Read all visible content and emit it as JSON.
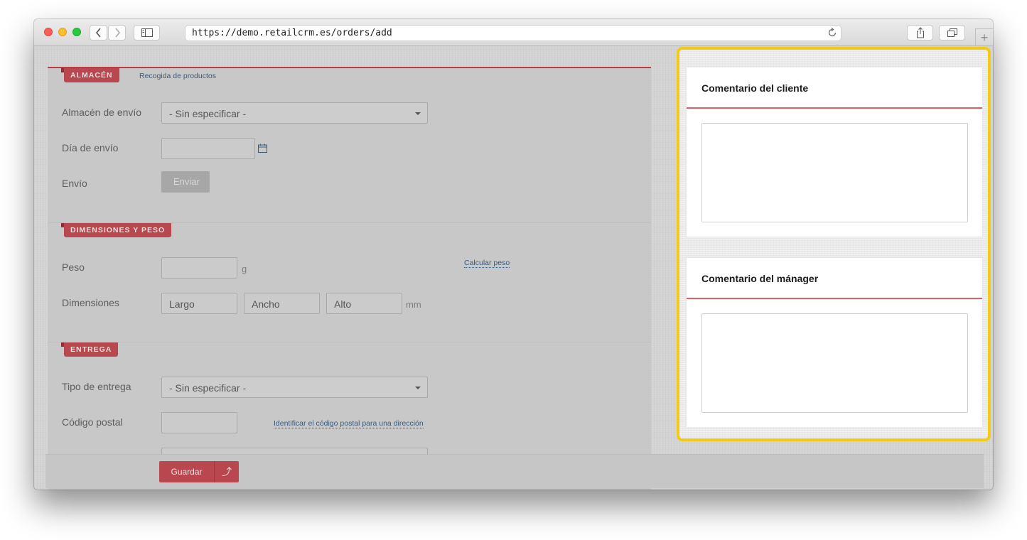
{
  "browser": {
    "url": "https://demo.retailcrm.es/orders/add"
  },
  "warehouse": {
    "tag": "ALMACÉN",
    "tag_link": "Recogida de productos",
    "ship_warehouse_label": "Almacén de envío",
    "ship_warehouse_value": "- Sin especificar -",
    "ship_day_label": "Día de envío",
    "shipment_label": "Envío",
    "send_button": "Enviar"
  },
  "dimensions": {
    "tag": "DIMENSIONES Y PESO",
    "weight_label": "Peso",
    "weight_unit": "g",
    "calc_weight_link": "Calcular peso",
    "dims_label": "Dimensiones",
    "length_placeholder": "Largo",
    "width_placeholder": "Ancho",
    "height_placeholder": "Alto",
    "dims_unit": "mm"
  },
  "delivery": {
    "tag": "ENTREGA",
    "type_label": "Tipo de entrega",
    "type_value": "- Sin especificar -",
    "postal_label": "Código postal",
    "postal_link": "Identificar el código postal para una dirección"
  },
  "savebar": {
    "save_label": "Guardar",
    "arrow": "⤴"
  },
  "comments": {
    "customer_title": "Comentario del cliente",
    "manager_title": "Comentario del mánager"
  },
  "colors": {
    "accent": "#e35d63",
    "highlight": "#f2cb17"
  }
}
